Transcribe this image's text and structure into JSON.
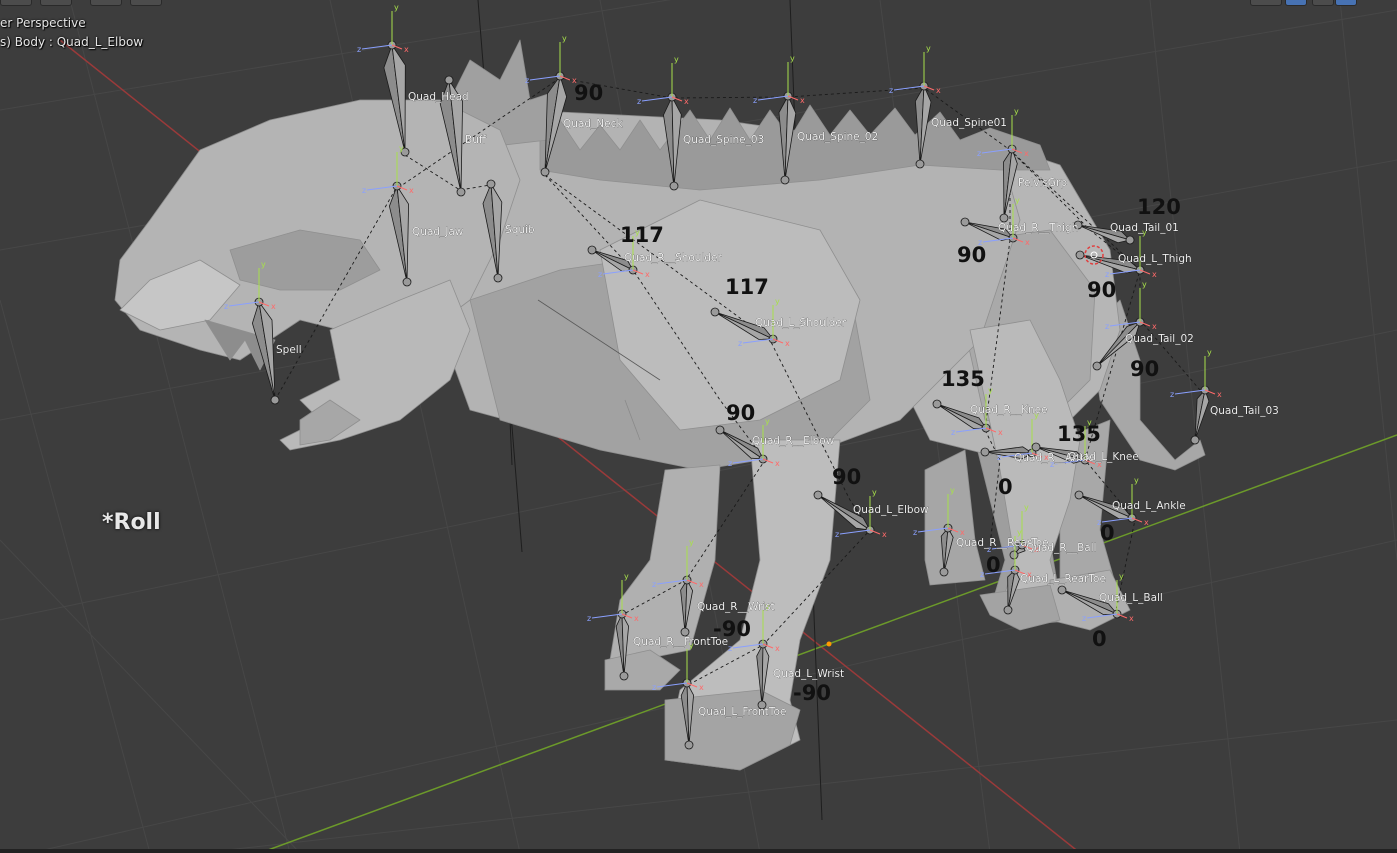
{
  "viewport": {
    "view_name": "er Perspective",
    "object_info": "s) Body : Quad_L_Elbow",
    "annotation_title": "*Roll"
  },
  "colors": {
    "background": "#3d3d3d",
    "grid": "#474747",
    "x_axis": "#9a3a3a",
    "y_axis": "#6c9a2a",
    "mesh_light": "#bdbdbd",
    "mesh_mid": "#a4a4a4",
    "mesh_dark": "#8a8a8a",
    "bone": "#9b9b9b",
    "bone_label": "#f0f0f0",
    "roll_label": "#111111",
    "accent_blue": "#4772b3"
  },
  "bones": [
    {
      "name": "Quad_Head"
    },
    {
      "name": "Buff"
    },
    {
      "name": "Quad_Neck"
    },
    {
      "name": "Quad_Spine_03"
    },
    {
      "name": "Quad_Spine_02"
    },
    {
      "name": "Quad_Spine01"
    },
    {
      "name": "PelvisGrp"
    },
    {
      "name": "Quad_Jaw"
    },
    {
      "name": "Squib"
    },
    {
      "name": "Spell"
    },
    {
      "name": "Quad_R__Shoulder"
    },
    {
      "name": "Quad_L_Shoulder"
    },
    {
      "name": "Quad_R__Thigh"
    },
    {
      "name": "Quad_Tail_01"
    },
    {
      "name": "Quad_L_Thigh"
    },
    {
      "name": "Quad_Tail_02"
    },
    {
      "name": "Quad_Tail_03"
    },
    {
      "name": "Quad_R__Knee"
    },
    {
      "name": "Quad_R__Ankle"
    },
    {
      "name": "Quad_L_Knee"
    },
    {
      "name": "Quad_R__Elbow"
    },
    {
      "name": "Quad_L_Elbow"
    },
    {
      "name": "Quad_L_Ankle"
    },
    {
      "name": "Quad_R__RearToe"
    },
    {
      "name": "Quad_R__Ball"
    },
    {
      "name": "Quad_L_RearToe"
    },
    {
      "name": "Quad_L_Ball"
    },
    {
      "name": "Quad_R__Wrist"
    },
    {
      "name": "Quad_R__FrontToe"
    },
    {
      "name": "Quad_L_Wrist"
    },
    {
      "name": "Quad_L_FrontToe"
    }
  ],
  "roll_labels": [
    {
      "value": "90"
    },
    {
      "value": "117"
    },
    {
      "value": "117"
    },
    {
      "value": "90"
    },
    {
      "value": "120"
    },
    {
      "value": "90"
    },
    {
      "value": "90"
    },
    {
      "value": "90"
    },
    {
      "value": "135"
    },
    {
      "value": "135"
    },
    {
      "value": "90"
    },
    {
      "value": "0"
    },
    {
      "value": "0"
    },
    {
      "value": "0"
    },
    {
      "value": "0"
    },
    {
      "value": "-90"
    },
    {
      "value": "-90"
    }
  ],
  "axis_letters": {
    "x": "x",
    "y": "y",
    "z": "z"
  }
}
